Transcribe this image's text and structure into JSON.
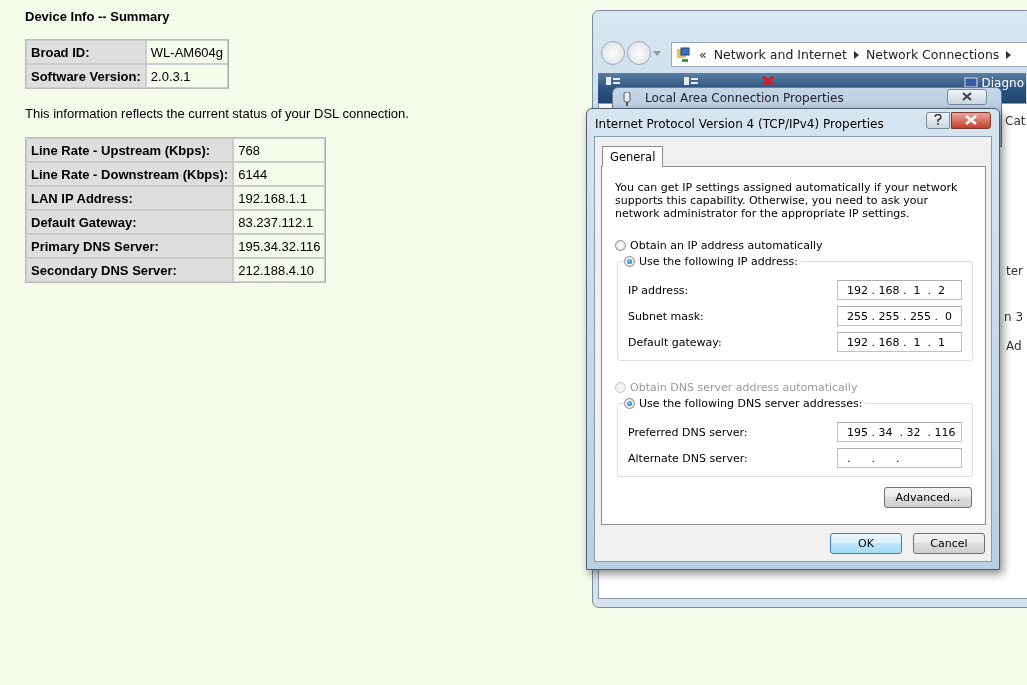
{
  "page": {
    "title": "Device Info -- Summary",
    "device_table": [
      {
        "label": "Broad ID:",
        "value": "WL-AM604g"
      },
      {
        "label": "Software Version:",
        "value": "2.0.3.1"
      }
    ],
    "note": "This information reflects the current status of your DSL connection.",
    "status_table": [
      {
        "label": "Line Rate - Upstream (Kbps):",
        "value": "768"
      },
      {
        "label": "Line Rate - Downstream (Kbps):",
        "value": "6144"
      },
      {
        "label": "LAN IP Address:",
        "value": "192.168.1.1"
      },
      {
        "label": "Default Gateway:",
        "value": "83.237.112.1"
      },
      {
        "label": "Primary DNS Server:",
        "value": "195.34.32.116"
      },
      {
        "label": "Secondary DNS Server:",
        "value": "212.188.4.10"
      }
    ]
  },
  "explorer_window": {
    "breadcrumb_prefix": "«",
    "breadcrumb": [
      "Network and Internet",
      "Network Connections"
    ],
    "toolbar": [
      {
        "kind": "menu"
      },
      {
        "kind": "menu"
      },
      {
        "kind": "disable"
      },
      {
        "label": "Diagno",
        "kind": "diagnose"
      }
    ],
    "peek_texts": [
      "Cat",
      "ter",
      "n 3",
      "Ad"
    ]
  },
  "lac_dialog": {
    "title": "Local Area Connection Properties"
  },
  "ipv4_dialog": {
    "title": "Internet Protocol Version 4 (TCP/IPv4) Properties",
    "tabs": [
      {
        "label": "General",
        "selected": true
      }
    ],
    "intro": "You can get IP settings assigned automatically if your network supports this capability. Otherwise, you need to ask your network administrator for the appropriate IP settings.",
    "groups": [
      {
        "auto_option": {
          "label": "Obtain an IP address automatically",
          "selected": false,
          "disabled": false
        },
        "manual_option": {
          "label": "Use the following IP address:",
          "selected": true,
          "disabled": false
        },
        "fields": [
          {
            "label": "IP address:",
            "value": "192 . 168 .  1  .  2"
          },
          {
            "label": "Subnet mask:",
            "value": "255 . 255 . 255 .  0"
          },
          {
            "label": "Default gateway:",
            "value": "192 . 168 .  1  .  1"
          }
        ]
      },
      {
        "auto_option": {
          "label": "Obtain DNS server address automatically",
          "selected": false,
          "disabled": true
        },
        "manual_option": {
          "label": "Use the following DNS server addresses:",
          "selected": true,
          "disabled": false
        },
        "fields": [
          {
            "label": "Preferred DNS server:",
            "value": "195 . 34  . 32  . 116"
          },
          {
            "label": "Alternate DNS server:",
            "value": ".      .      ."
          }
        ]
      }
    ],
    "advanced_button": "Advanced...",
    "buttons": [
      {
        "label": "OK",
        "default": true
      },
      {
        "label": "Cancel",
        "default": false
      }
    ]
  }
}
